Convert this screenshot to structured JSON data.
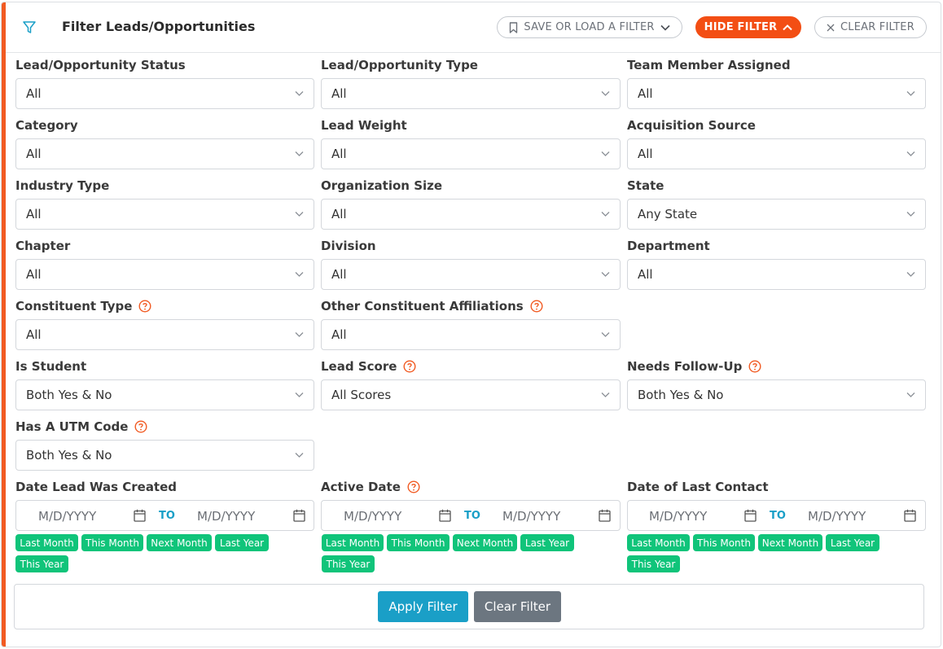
{
  "header": {
    "title": "Filter Leads/Opportunities",
    "save_load_label": "SAVE OR LOAD A FILTER",
    "hide_filter_label": "HIDE FILTER",
    "clear_filter_label": "CLEAR FILTER"
  },
  "fields": {
    "lead_status": {
      "label": "Lead/Opportunity Status",
      "value": "All"
    },
    "lead_type": {
      "label": "Lead/Opportunity Type",
      "value": "All"
    },
    "team_member": {
      "label": "Team Member Assigned",
      "value": "All"
    },
    "category": {
      "label": "Category",
      "value": "All"
    },
    "lead_weight": {
      "label": "Lead Weight",
      "value": "All"
    },
    "acquisition_source": {
      "label": "Acquisition Source",
      "value": "All"
    },
    "industry_type": {
      "label": "Industry Type",
      "value": "All"
    },
    "organization_size": {
      "label": "Organization Size",
      "value": "All"
    },
    "state": {
      "label": "State",
      "value": "Any State"
    },
    "chapter": {
      "label": "Chapter",
      "value": "All"
    },
    "division": {
      "label": "Division",
      "value": "All"
    },
    "department": {
      "label": "Department",
      "value": "All"
    },
    "constituent_type": {
      "label": "Constituent Type",
      "value": "All"
    },
    "other_affiliations": {
      "label": "Other Constituent Affiliations",
      "value": "All"
    },
    "is_student": {
      "label": "Is Student",
      "value": "Both Yes & No"
    },
    "lead_score": {
      "label": "Lead Score",
      "value": "All Scores"
    },
    "needs_followup": {
      "label": "Needs Follow-Up",
      "value": "Both Yes & No"
    },
    "utm_code": {
      "label": "Has A UTM Code",
      "value": "Both Yes & No"
    }
  },
  "dates": {
    "placeholder": "M/D/YYYY",
    "to_label": "TO",
    "created": {
      "label": "Date Lead Was Created"
    },
    "active": {
      "label": "Active Date"
    },
    "last_contact": {
      "label": "Date of Last Contact"
    },
    "quick_ranges": [
      "Last Month",
      "This Month",
      "Next Month",
      "Last Year",
      "This Year"
    ]
  },
  "footer": {
    "apply_label": "Apply Filter",
    "clear_label": "Clear Filter"
  },
  "colors": {
    "accent": "#f15a22",
    "hide_button": "#f34e14",
    "apply_button": "#1a9fc7",
    "clear_button": "#6c7680",
    "quick_range": "#10c47a",
    "help_icon": "#f15a22"
  },
  "icons": [
    "filter-icon",
    "bookmark-icon",
    "chevron-down-icon",
    "chevron-up-icon",
    "close-icon",
    "help-icon",
    "calendar-icon"
  ]
}
